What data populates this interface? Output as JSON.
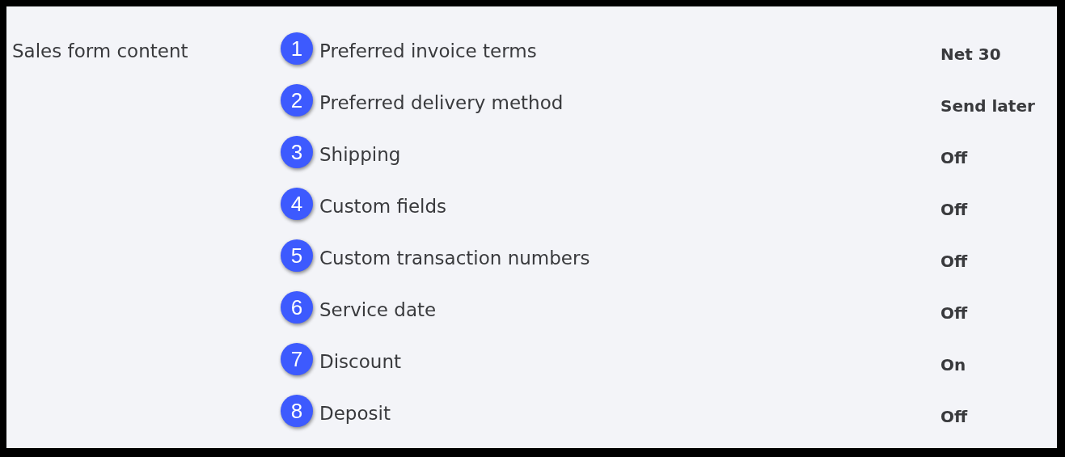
{
  "section": {
    "title": "Sales form content"
  },
  "settings": [
    {
      "marker": "1",
      "label": "Preferred invoice terms",
      "value": "Net 30"
    },
    {
      "marker": "2",
      "label": "Preferred delivery method",
      "value": "Send later"
    },
    {
      "marker": "3",
      "label": "Shipping",
      "value": "Off"
    },
    {
      "marker": "4",
      "label": "Custom fields",
      "value": "Off"
    },
    {
      "marker": "5",
      "label": "Custom transaction numbers",
      "value": "Off"
    },
    {
      "marker": "6",
      "label": "Service date",
      "value": "Off"
    },
    {
      "marker": "7",
      "label": "Discount",
      "value": "On"
    },
    {
      "marker": "8",
      "label": "Deposit",
      "value": "Off"
    }
  ]
}
